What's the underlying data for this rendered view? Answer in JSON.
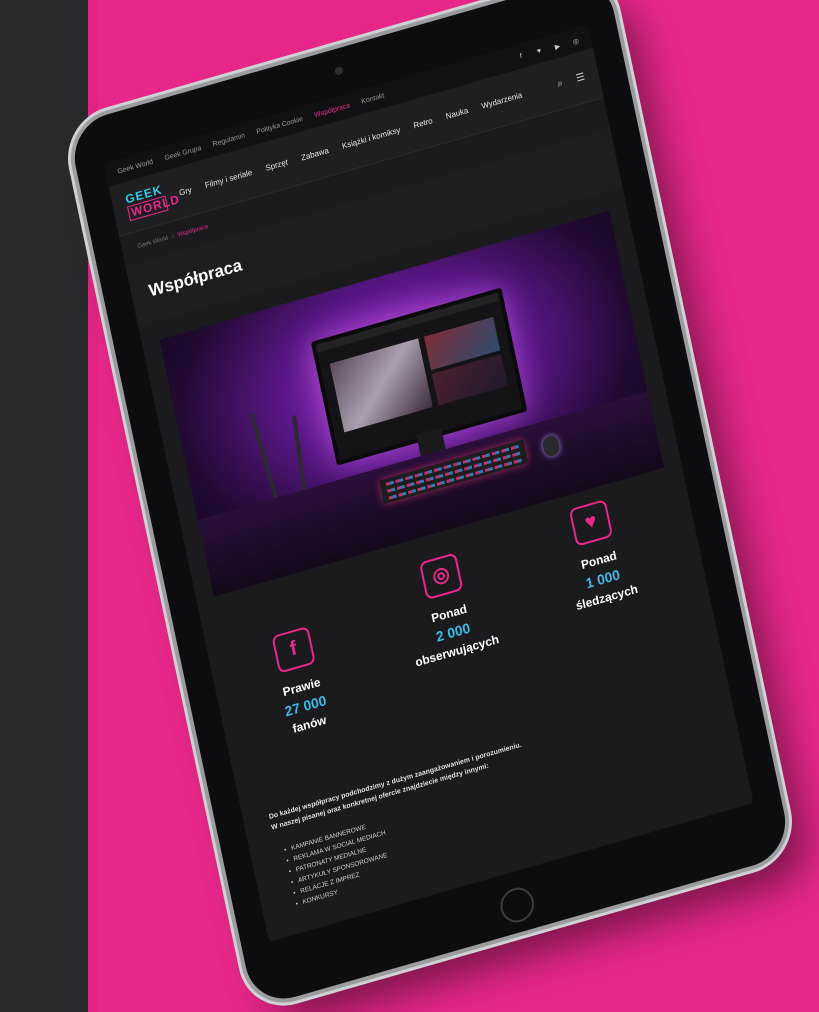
{
  "colors": {
    "accent": "#e8288a",
    "highlight": "#3fb9e8",
    "background": "#1b1b1d"
  },
  "topbar": {
    "links": [
      "Geek World",
      "Geek Grupa",
      "Regulamin",
      "Polityka Cookie",
      "Współpraca",
      "Kontakt"
    ],
    "active_index": 4,
    "social_icons": [
      "facebook-icon",
      "twitter-icon",
      "youtube-icon",
      "instagram-icon"
    ]
  },
  "navbar": {
    "logo_line1": "GEEK",
    "logo_line2": "WORLD",
    "items": [
      "Gry",
      "Filmy i seriale",
      "Sprzęt",
      "Zabawa",
      "Książki i komiksy",
      "Retro",
      "Nauka",
      "Wydarzenia"
    ]
  },
  "breadcrumb": {
    "home": "Geek World",
    "separator": "›",
    "current": "Współpraca"
  },
  "page": {
    "title": "Współpraca"
  },
  "stats": {
    "facebook": {
      "icon": "facebook-icon",
      "prefix": "Prawie",
      "number": "27 000",
      "suffix": "fanów"
    },
    "instagram": {
      "icon": "instagram-icon",
      "prefix": "Ponad",
      "number": "2 000",
      "suffix": "obserwujących"
    },
    "twitter": {
      "icon": "twitter-icon",
      "prefix": "Ponad",
      "number": "1 000",
      "suffix": "śledzących"
    }
  },
  "intro": {
    "line1": "Do każdej współpracy podchodzimy z dużym zaangażowaniem i porozumieniu.",
    "line2": "W naszej pisanej oraz konkretnej ofercie znajdziecie między innymi:"
  },
  "offers": [
    "KAMPANIE BANNEROWE",
    "REKLAMA W SOCIAL MEDIACH",
    "PATRONATY MEDIALNE",
    "ARTYKUŁY SPONSOROWANE",
    "RELACJE Z IMPREZ",
    "KONKURSY"
  ]
}
